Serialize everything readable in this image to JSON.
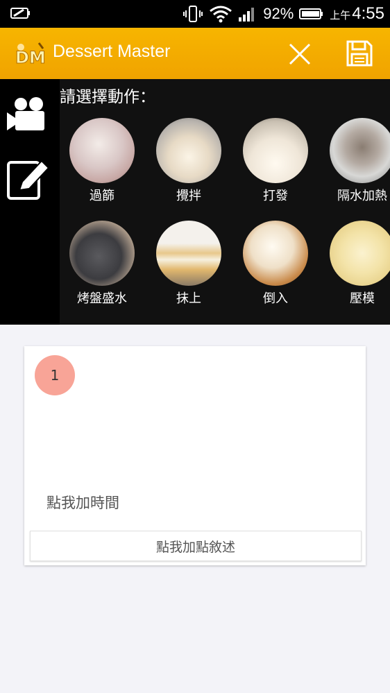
{
  "status_bar": {
    "battery_percent": "92%",
    "ampm": "上午",
    "time": "4:55"
  },
  "app_bar": {
    "title": "Dessert Master",
    "logo_text": "DM"
  },
  "action_panel": {
    "prompt": "請選擇動作：",
    "actions": [
      {
        "label": "過篩"
      },
      {
        "label": "攪拌"
      },
      {
        "label": "打發"
      },
      {
        "label": "隔水加熱"
      },
      {
        "label": "烤盤盛水"
      },
      {
        "label": "抹上"
      },
      {
        "label": "倒入"
      },
      {
        "label": "壓模"
      }
    ]
  },
  "step_card": {
    "step_number": "1",
    "time_link": "點我加時間",
    "description_button": "點我加點敘述"
  },
  "colors": {
    "app_bar": "#f5ad00",
    "badge": "#f8a497",
    "background": "#f3f3f8"
  }
}
